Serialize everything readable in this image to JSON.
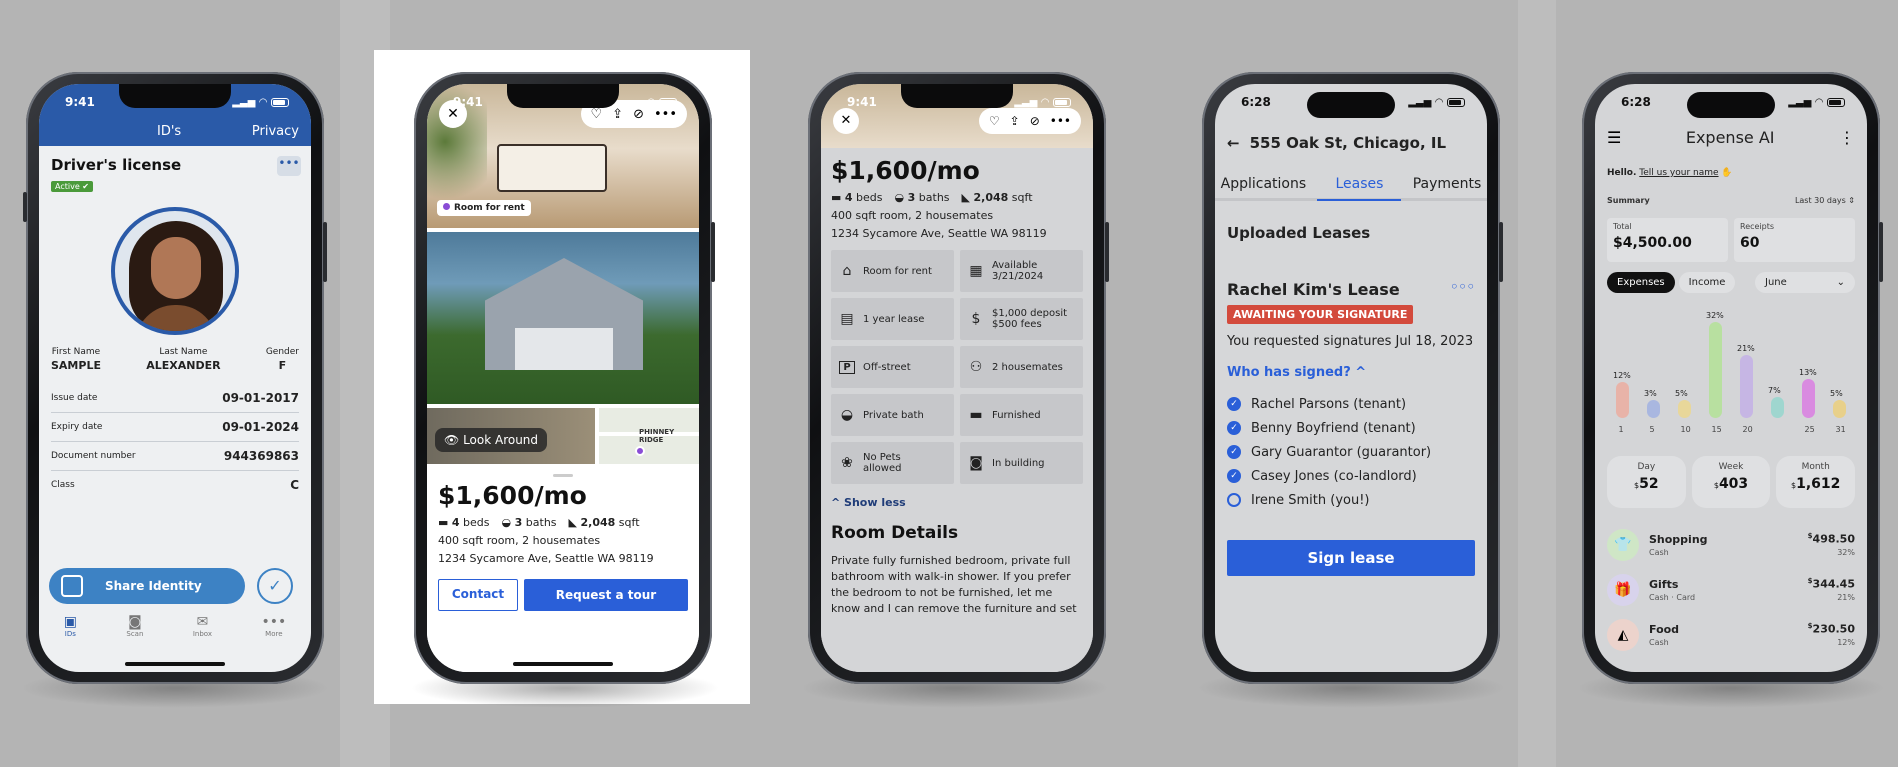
{
  "colors": {
    "id_blue": "#2a5aa8",
    "rent_blue": "#2a5fd8",
    "await_red": "#d34a3c",
    "active_green": "#4a9a3a"
  },
  "phone1": {
    "time": "9:41",
    "nav_title": "ID's",
    "nav_privacy": "Privacy",
    "card_title": "Driver's license",
    "status_badge": "Active ✔",
    "more": "•••",
    "fields": [
      {
        "label": "First Name",
        "value": "SAMPLE"
      },
      {
        "label": "Last Name",
        "value": "ALEXANDER"
      },
      {
        "label": "Gender",
        "value": "F"
      }
    ],
    "rows": [
      {
        "label": "Issue date",
        "value": "09-01-2017"
      },
      {
        "label": "Expiry date",
        "value": "09-01-2024"
      },
      {
        "label": "Document number",
        "value": "944369863"
      },
      {
        "label": "Class",
        "value": "C"
      }
    ],
    "share_label": "Share Identity",
    "tabs": [
      {
        "label": "IDs",
        "icon": "id-icon"
      },
      {
        "label": "Scan",
        "icon": "camera-icon"
      },
      {
        "label": "Inbox",
        "icon": "inbox-icon"
      },
      {
        "label": "More",
        "icon": "more-icon"
      }
    ]
  },
  "phone2": {
    "time": "9:41",
    "room_tag": "Room for rent",
    "look_around": "Look Around",
    "map_label": "PHINNEY RIDGE",
    "price": "$1,600/mo",
    "beds": "4",
    "beds_label": "beds",
    "baths": "3",
    "baths_label": "baths",
    "sqft": "2,048",
    "sqft_label": "sqft",
    "room_desc": "400 sqft room, 2 housemates",
    "address": "1234 Sycamore Ave, Seattle WA 98119",
    "contact": "Contact",
    "tour": "Request a tour"
  },
  "phone3": {
    "time": "9:41",
    "price": "$1,600/mo",
    "beds": "4",
    "beds_label": "beds",
    "baths": "3",
    "baths_label": "baths",
    "sqft": "2,048",
    "sqft_label": "sqft",
    "room_desc": "400 sqft room, 2 housemates",
    "address": "1234 Sycamore Ave, Seattle WA 98119",
    "amenities": [
      {
        "label": "Room for rent",
        "icon": "home-icon"
      },
      {
        "label": "Available\n3/21/2024",
        "icon": "calendar-icon"
      },
      {
        "label": "1 year lease",
        "icon": "document-icon"
      },
      {
        "label": "$1,000 deposit\n$500 fees",
        "icon": "dollar-icon"
      },
      {
        "label": "Off-street",
        "icon": "parking-icon"
      },
      {
        "label": "2 housemates",
        "icon": "people-icon"
      },
      {
        "label": "Private bath",
        "icon": "bath-icon"
      },
      {
        "label": "Furnished",
        "icon": "bed-icon"
      },
      {
        "label": "No Pets\nallowed",
        "icon": "paw-icon"
      },
      {
        "label": "In building",
        "icon": "laundry-icon"
      }
    ],
    "show_less": "Show less",
    "room_details": "Room Details",
    "description": "Private fully furnished bedroom, private full bathroom with walk-in shower. If you prefer the bedroom to not be furnished, let me know and I can remove the furniture and set"
  },
  "phone4": {
    "time": "6:28",
    "address": "555 Oak St, Chicago, IL",
    "tabs": [
      "Applications",
      "Leases",
      "Payments"
    ],
    "section": "Uploaded Leases",
    "lease_title": "Rachel Kim's Lease",
    "more": "◦◦◦",
    "status": "AWAITING YOUR SIGNATURE",
    "requested": "You requested signatures Jul 18, 2023",
    "who": "Who has signed?",
    "signers": [
      {
        "name": "Rachel Parsons (tenant)",
        "signed": true
      },
      {
        "name": "Benny Boyfriend (tenant)",
        "signed": true
      },
      {
        "name": "Gary Guarantor (guarantor)",
        "signed": true
      },
      {
        "name": "Casey Jones (co-landlord)",
        "signed": true
      },
      {
        "name": "Irene Smith (you!)",
        "signed": false
      }
    ],
    "sign": "Sign lease"
  },
  "phone5": {
    "time": "6:28",
    "title": "Expense AI",
    "hello": "Hello.",
    "hello_link": "Tell us your name",
    "summary": "Summary",
    "range": "Last 30 days",
    "total_label": "Total",
    "total_value": "$4,500.00",
    "receipts_label": "Receipts",
    "receipts_value": "60",
    "pill_expenses": "Expenses",
    "pill_income": "Income",
    "month": "June",
    "periods": [
      {
        "label": "Day",
        "value": "52"
      },
      {
        "label": "Week",
        "value": "403"
      },
      {
        "label": "Month",
        "value": "1,612"
      }
    ],
    "categories": [
      {
        "name": "Shopping",
        "sub": "Cash",
        "amount": "498.50",
        "pct": "32%",
        "icon": "shirt-icon"
      },
      {
        "name": "Gifts",
        "sub": "Cash · Card",
        "amount": "344.45",
        "pct": "21%",
        "icon": "gift-icon"
      },
      {
        "name": "Food",
        "sub": "Cash",
        "amount": "230.50",
        "pct": "12%",
        "icon": "pizza-icon"
      }
    ]
  },
  "chart_data": {
    "type": "bar",
    "categories": [
      "1",
      "5",
      "10",
      "15",
      "20",
      "25",
      "31"
    ],
    "values": [
      12,
      3,
      5,
      32,
      21,
      7,
      13,
      5
    ],
    "value_labels": [
      "12%",
      "3%",
      "5%",
      "32%",
      "21%",
      "7%",
      "13%",
      "5%"
    ],
    "colors": [
      "#e8b3a8",
      "#a9b7e0",
      "#e8d79a",
      "#b8e0a0",
      "#c6b6e4",
      "#9fd6cf",
      "#d98be0",
      "#e8d08a"
    ],
    "ylim": [
      0,
      32
    ]
  }
}
